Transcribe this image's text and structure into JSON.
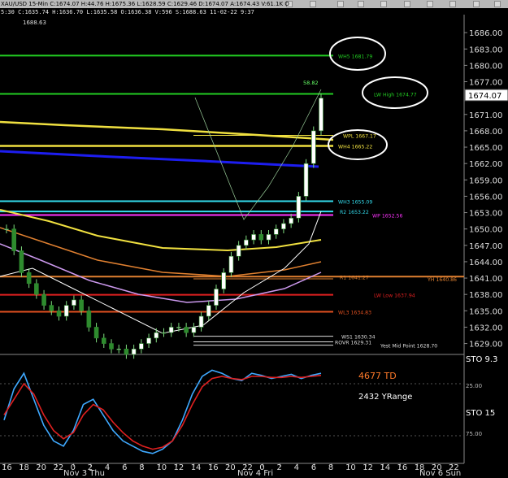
{
  "header": {
    "title": "XAU/USD 15-Min C:1674.07 H:44.76 H:1675.36 L:1628.59 C:1629.46 D:1674.07 A:1674.43 V:61.1K O",
    "ohlc_line": "5:30 C:1635.74 H:1636.70 L:1635.58 O:1636.38 V:596 S:1688.63 11-02-22 9:37",
    "top_price": "1688.63"
  },
  "chart_data": [
    {
      "type": "line",
      "panel": "price",
      "y_ticks": [
        1629.0,
        1632.0,
        1635.0,
        1638.0,
        1641.0,
        1644.0,
        1647.0,
        1650.0,
        1653.0,
        1656.0,
        1659.0,
        1662.0,
        1665.0,
        1668.0,
        1671.0,
        1677.0,
        1680.0,
        1683.0,
        1686.0
      ],
      "last_price": "1674.07",
      "ylim": [
        1627,
        1689
      ],
      "levels": [
        {
          "label": "WH5 1681.79",
          "value": 1681.79,
          "color": "#22cc22"
        },
        {
          "label": "LW High 1674.77",
          "value": 1674.77,
          "color": "#22cc22"
        },
        {
          "label": "WPL 1667.17",
          "value": 1667.17,
          "color": "#f0e040"
        },
        {
          "label": "WH4 1665.22",
          "value": 1665.22,
          "color": "#f0e040"
        },
        {
          "label": "WH3 1655.09",
          "value": 1655.09,
          "color": "#33ddee"
        },
        {
          "label": "R2 1653.22",
          "value": 1653.22,
          "color": "#33ddee"
        },
        {
          "label": "WP 1652.56",
          "value": 1652.56,
          "color": "#ff33ff"
        },
        {
          "label": "R1 1641.27",
          "value": 1641.27,
          "color": "#e08030"
        },
        {
          "label": "YH 1640.86",
          "value": 1640.86,
          "color": "#e08030"
        },
        {
          "label": "LW Low 1637.94",
          "value": 1637.94,
          "color": "#e02020"
        },
        {
          "label": "WL3 1634.83",
          "value": 1634.83,
          "color": "#e05020"
        },
        {
          "label": "WS1 1630.34",
          "value": 1630.34,
          "color": "#dddddd"
        },
        {
          "label": "Yest Mid Point 1628.70",
          "value": 1628.7,
          "color": "#dddddd"
        },
        {
          "label": "ROVR 1629.31",
          "value": 1629.31,
          "color": "#dddddd"
        }
      ],
      "annotation": "58.82",
      "series": [
        {
          "values": [
            1650,
            1646,
            1642,
            1640,
            1638,
            1636,
            1635,
            1634,
            1636,
            1637,
            1635,
            1632,
            1630,
            1629,
            1628,
            1628,
            1627,
            1628,
            1629,
            1630,
            1631,
            1631,
            1632,
            1632,
            1631,
            1632,
            1634,
            1636,
            1639,
            1642,
            1645,
            1647,
            1648,
            1649,
            1648,
            1649,
            1650,
            1651,
            1652,
            1656,
            1662,
            1668,
            1674
          ]
        }
      ]
    },
    {
      "type": "line",
      "panel": "stochastic",
      "y_ticks": [
        "25.00",
        "75.00"
      ],
      "labels": [
        "STO 9.3",
        "STO 15"
      ],
      "series": [
        {
          "values": [
            40,
            70,
            85,
            60,
            35,
            20,
            15,
            30,
            55,
            60,
            45,
            30,
            20,
            15,
            10,
            8,
            12,
            20,
            40,
            65,
            82,
            88,
            85,
            80,
            78,
            85,
            83,
            80,
            82,
            84,
            80,
            83,
            85
          ]
        },
        {
          "values": [
            45,
            60,
            75,
            65,
            45,
            30,
            22,
            28,
            45,
            55,
            50,
            38,
            28,
            20,
            15,
            12,
            14,
            20,
            35,
            55,
            72,
            80,
            82,
            80,
            79,
            82,
            82,
            81,
            81,
            82,
            81,
            82,
            83
          ]
        }
      ]
    }
  ],
  "overlays": {
    "td_text": "4677 TD",
    "yrange_text": "2432 YRange"
  },
  "time_axis": {
    "ticks": [
      "16",
      "18",
      "20",
      "22",
      "0",
      "2",
      "4",
      "6",
      "8",
      "10",
      "12",
      "14",
      "16",
      "20",
      "22",
      "0",
      "2",
      "4",
      "6",
      "8",
      "10",
      "12",
      "14",
      "16",
      "18",
      "20",
      "22"
    ],
    "day_labels": [
      "Nov 3 Thu",
      "Nov 4 Fri",
      "Nov 6 Sun"
    ]
  }
}
